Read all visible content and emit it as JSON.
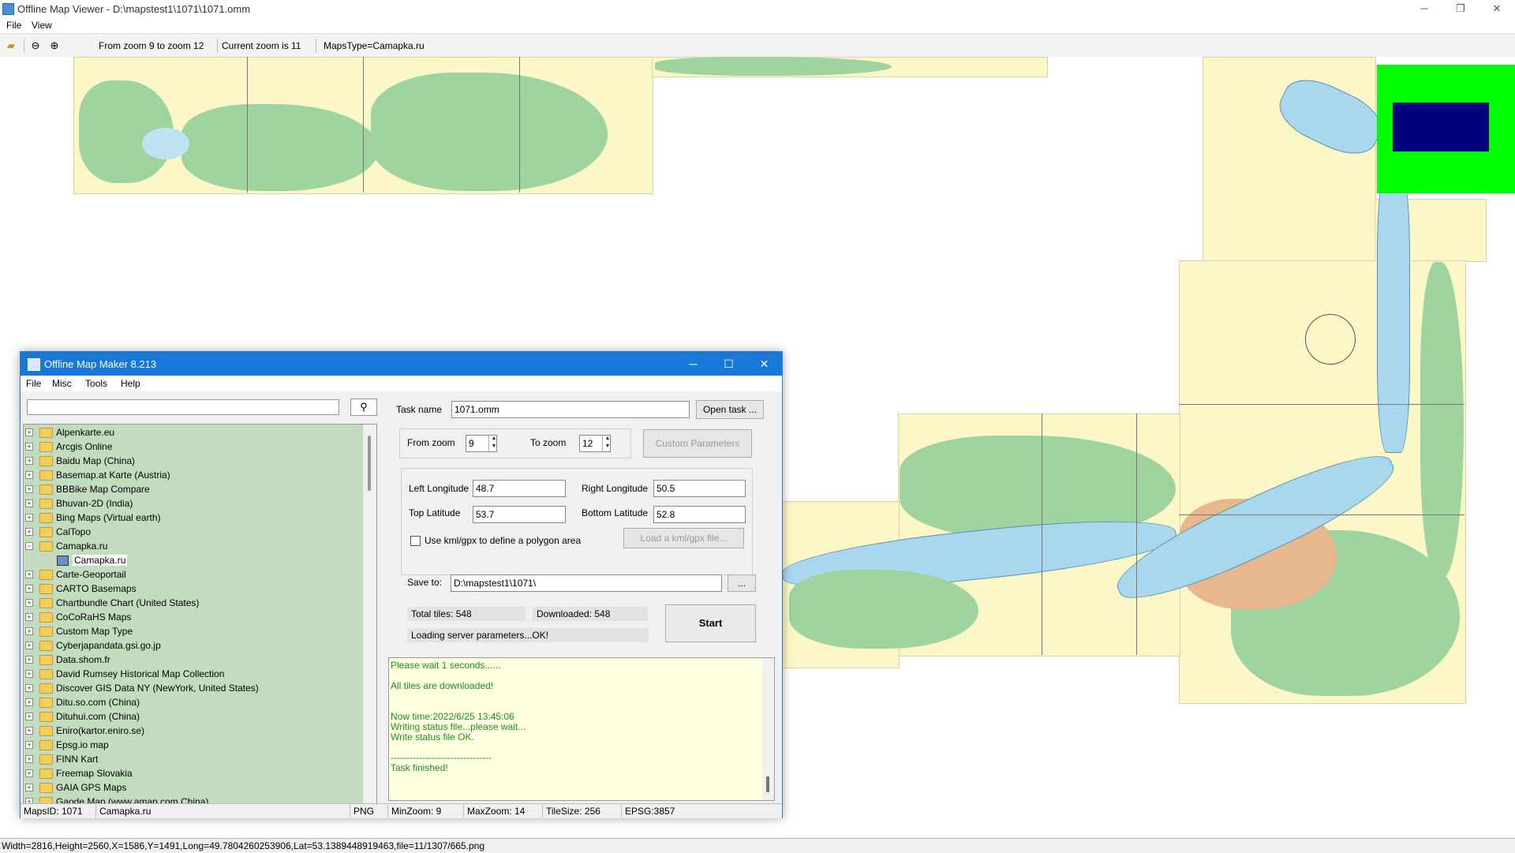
{
  "viewer": {
    "title": "Offline Map Viewer - D:\\mapstest1\\1071\\1071.omm",
    "menu": [
      "File",
      "View"
    ],
    "toolbar": {
      "zoom_range": "From zoom 9 to zoom 12",
      "current_zoom": "Current zoom is 11",
      "maps_type": "MapsType=Camapka.ru"
    },
    "status_text": "Width=2816,Height=2560,X=1586,Y=1491,Long=49.7804260253906,Lat=53.1389448919463,file=11/1307/665.png"
  },
  "maker": {
    "title": "Offline Map Maker 8.213",
    "menu": [
      "File",
      "Misc",
      "Tools",
      "Help"
    ],
    "search_placeholder": "",
    "tree": [
      {
        "label": "Alpenkarte.eu",
        "expanded": false
      },
      {
        "label": "Arcgis Online",
        "expanded": false
      },
      {
        "label": "Baidu Map (China)",
        "expanded": false
      },
      {
        "label": "Basemap.at Karte (Austria)",
        "expanded": false
      },
      {
        "label": "BBBike Map Compare",
        "expanded": false
      },
      {
        "label": "Bhuvan-2D (India)",
        "expanded": false
      },
      {
        "label": "Bing Maps (Virtual earth)",
        "expanded": false
      },
      {
        "label": "CalTopo",
        "expanded": false
      },
      {
        "label": "Camapka.ru",
        "expanded": true
      },
      {
        "label": "Camapka.ru",
        "child": true
      },
      {
        "label": "Carte-Geoportail",
        "expanded": false
      },
      {
        "label": "CARTO Basemaps",
        "expanded": false
      },
      {
        "label": "Chartbundle Chart (United States)",
        "expanded": false
      },
      {
        "label": "CoCoRaHS Maps",
        "expanded": false
      },
      {
        "label": "Custom Map Type",
        "expanded": false
      },
      {
        "label": "Cyberjapandata.gsi.go.jp",
        "expanded": false
      },
      {
        "label": "Data.shom.fr",
        "expanded": false
      },
      {
        "label": "David Rumsey Historical Map Collection",
        "expanded": false
      },
      {
        "label": "Discover GIS Data NY (NewYork, United States)",
        "expanded": false
      },
      {
        "label": "Ditu.so.com (China)",
        "expanded": false
      },
      {
        "label": "Dituhui.com (China)",
        "expanded": false
      },
      {
        "label": "Eniro(kartor.eniro.se)",
        "expanded": false
      },
      {
        "label": "Epsg.io map",
        "expanded": false
      },
      {
        "label": "FINN Kart",
        "expanded": false
      },
      {
        "label": "Freemap Slovakia",
        "expanded": false
      },
      {
        "label": "GAIA GPS Maps",
        "expanded": false
      },
      {
        "label": "Gaode Map (www.amap.com China)",
        "expanded": false
      }
    ],
    "task_name_label": "Task name",
    "task_name_value": "1071.omm",
    "open_task_label": "Open task ...",
    "from_zoom_label": "From zoom",
    "from_zoom_value": "9",
    "to_zoom_label": "To zoom",
    "to_zoom_value": "12",
    "custom_params_label": "Custom Parameters",
    "left_long_label": "Left Longitude",
    "left_long_value": "48.7",
    "right_long_label": "Right Longitude",
    "right_long_value": "50.5",
    "top_lat_label": "Top Latitude",
    "top_lat_value": "53.7",
    "bottom_lat_label": "Bottom Latitude",
    "bottom_lat_value": "52.8",
    "kml_checkbox_label": "Use kml/gpx to define a polygon area",
    "load_kml_label": "Load a kml/gpx file...",
    "save_to_label": "Save to:",
    "save_to_value": "D:\\mapstest1\\1071\\",
    "browse_label": "...",
    "total_tiles": "Total tiles: 548",
    "downloaded": "Downloaded: 548",
    "loading_status": "Loading server parameters...OK!",
    "start_label": "Start",
    "log": [
      "Please wait 1 seconds......",
      "",
      "All tiles are downloaded!",
      "",
      "",
      "Now time:2022/6/25 13:45:06",
      "Writing status file...please wait...",
      "Write status file OK.",
      "",
      "--------------------------------",
      "Task finished!"
    ],
    "status": {
      "maps_id": "MapsID: 1071",
      "maps_name": "Camapka.ru",
      "format": "PNG",
      "min_zoom": "MinZoom: 9",
      "max_zoom": "MaxZoom: 14",
      "tile_size": "TileSize: 256",
      "epsg": "EPSG:3857"
    }
  },
  "colors": {
    "titlebar_blue": "#1878d8",
    "tree_bg": "#c3dcc0",
    "log_text": "#1f8f1f",
    "overlay_green": "#00ff00",
    "overlay_navy": "#00007f"
  }
}
